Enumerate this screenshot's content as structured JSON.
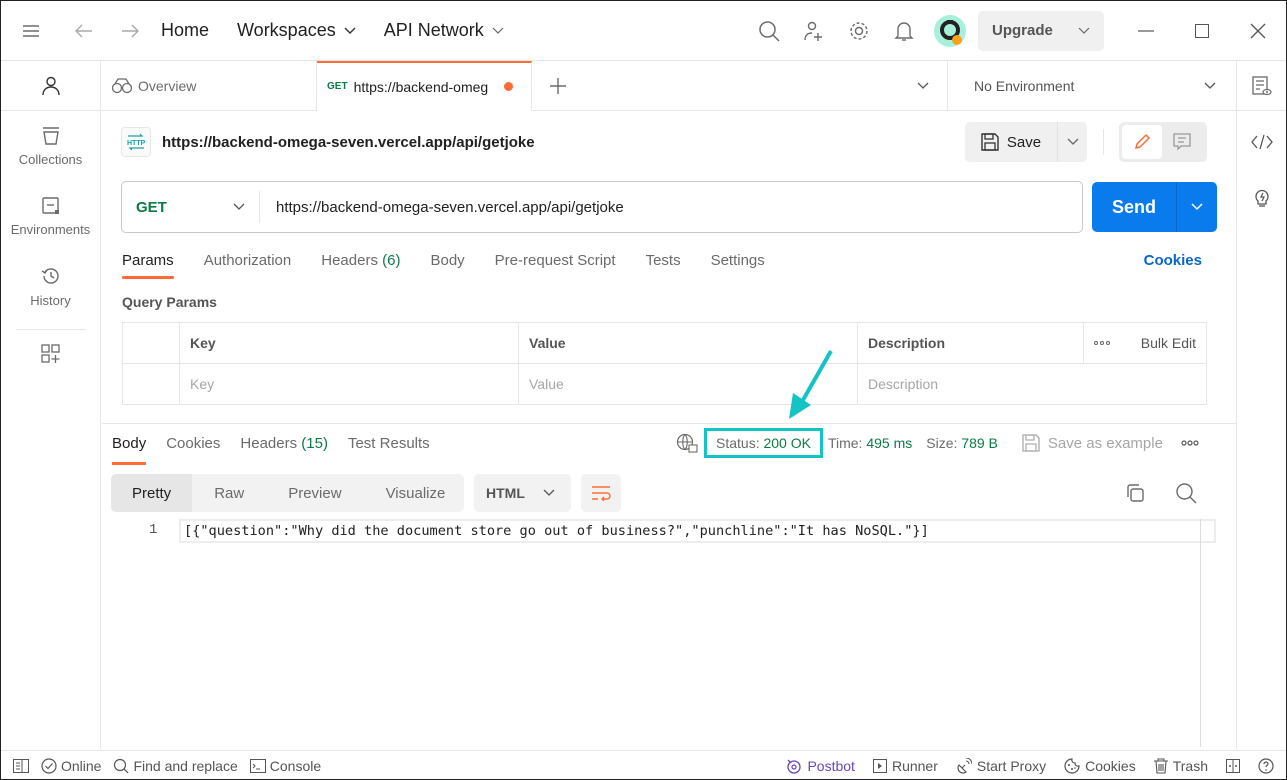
{
  "titlebar": {
    "nav": [
      "Home",
      "Workspaces",
      "API Network"
    ],
    "upgrade_label": "Upgrade"
  },
  "sidebar": {
    "items": [
      {
        "label": "Collections",
        "icon": "collections-icon"
      },
      {
        "label": "Environments",
        "icon": "environments-icon"
      },
      {
        "label": "History",
        "icon": "history-icon"
      }
    ]
  },
  "tabs": {
    "overview_label": "Overview",
    "active_method": "GET",
    "active_label": "https://backend-omeg",
    "environment": "No Environment"
  },
  "request": {
    "name": "https://backend-omega-seven.vercel.app/api/getjoke",
    "save_label": "Save",
    "method": "GET",
    "url": "https://backend-omega-seven.vercel.app/api/getjoke",
    "send_label": "Send",
    "tabs": [
      {
        "label": "Params"
      },
      {
        "label": "Authorization"
      },
      {
        "label": "Headers",
        "count": "(6)"
      },
      {
        "label": "Body"
      },
      {
        "label": "Pre-request Script"
      },
      {
        "label": "Tests"
      },
      {
        "label": "Settings"
      }
    ],
    "cookies_label": "Cookies"
  },
  "params": {
    "title": "Query Params",
    "headers": [
      "Key",
      "Value",
      "Description"
    ],
    "bulk_edit": "Bulk Edit",
    "placeholders": [
      "Key",
      "Value",
      "Description"
    ]
  },
  "response": {
    "tabs": [
      {
        "label": "Body"
      },
      {
        "label": "Cookies"
      },
      {
        "label": "Headers",
        "count": "(15)"
      },
      {
        "label": "Test Results"
      }
    ],
    "status_label": "Status:",
    "status_value": "200 OK",
    "time_label": "Time:",
    "time_value": "495 ms",
    "size_label": "Size:",
    "size_value": "789 B",
    "save_example": "Save as example",
    "views": [
      "Pretty",
      "Raw",
      "Preview",
      "Visualize"
    ],
    "format": "HTML",
    "line_number": "1",
    "body": "[{\"question\":\"Why did the document store go out of business?\",\"punchline\":\"It has NoSQL.\"}]"
  },
  "statusbar": {
    "online": "Online",
    "find_replace": "Find and replace",
    "console": "Console",
    "postbot": "Postbot",
    "runner": "Runner",
    "start_proxy": "Start Proxy",
    "cookies": "Cookies",
    "trash": "Trash"
  },
  "colors": {
    "accent": "#ff6c37",
    "send": "#097bed",
    "success": "#0c7b45",
    "annotation": "#14c4c4"
  }
}
